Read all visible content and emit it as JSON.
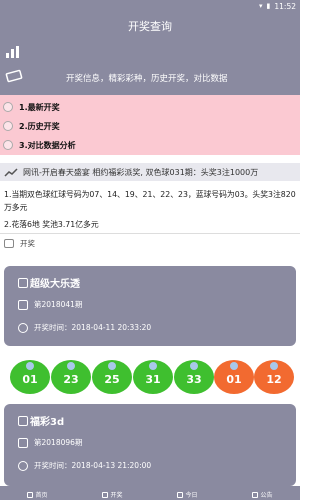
{
  "status": {
    "time": "11:52"
  },
  "header": {
    "title": "开奖查询",
    "tagline": "开奖信息，精彩彩种，历史开奖，对比数据"
  },
  "menu": {
    "items": [
      {
        "label": "1.最新开奖"
      },
      {
        "label": "2.历史开奖"
      },
      {
        "label": "3.对比数据分析"
      }
    ]
  },
  "news": {
    "marquee": "网讯-开启春天盛宴 相约福彩派奖, 双色球031期：头奖3注1000万",
    "line1": "1.当期双色球红球号码为07、14、19、21、22、23，蓝球号码为03。头奖3注820万多元",
    "line2": "2.花落6地 奖池3.71亿多元"
  },
  "section": {
    "label": "开奖"
  },
  "cards": [
    {
      "name": "超级大乐透",
      "issue": "第2018041期",
      "time": "开奖时间：2018-04-11 20:33:20"
    },
    {
      "name": "福彩3d",
      "issue": "第2018096期",
      "time": "开奖时间：2018-04-13 21:20:00"
    }
  ],
  "balls": [
    {
      "num": "01",
      "color": "green"
    },
    {
      "num": "23",
      "color": "green"
    },
    {
      "num": "25",
      "color": "green"
    },
    {
      "num": "31",
      "color": "green"
    },
    {
      "num": "33",
      "color": "green"
    },
    {
      "num": "01",
      "color": "red"
    },
    {
      "num": "12",
      "color": "red"
    }
  ],
  "tabs": [
    {
      "label": "首页"
    },
    {
      "label": "开奖"
    },
    {
      "label": "今日"
    },
    {
      "label": "公告"
    }
  ],
  "colors": {
    "header_bg": "#8a8aa0",
    "menu_bg": "#fbc9d2",
    "ball_green": "#3fbf2f",
    "ball_red": "#f26a30"
  }
}
